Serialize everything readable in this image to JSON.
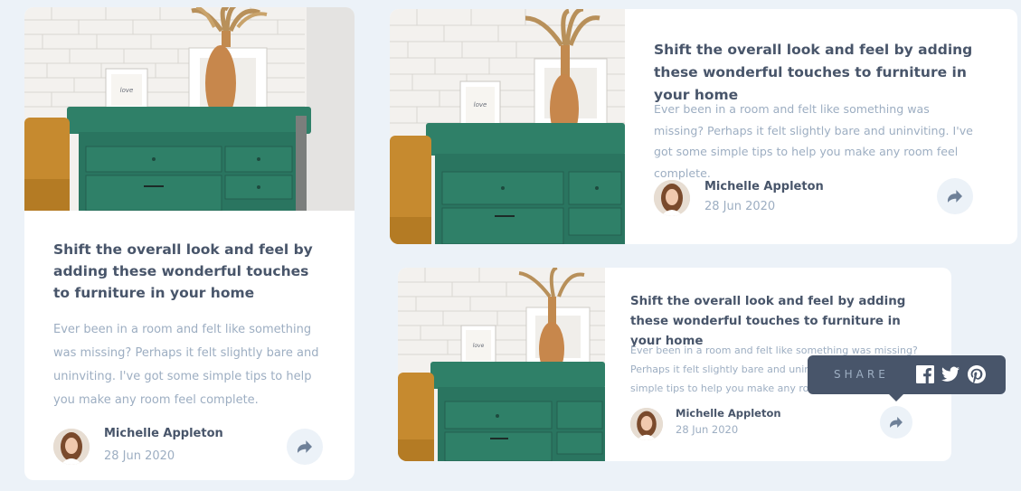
{
  "colors": {
    "background": "#ecf2f8",
    "card": "#ffffff",
    "title": "#48556a",
    "text": "#9daec2",
    "tooltip": "#48556a",
    "share_button_bg": "#ecf2f8"
  },
  "cards": [
    {
      "title": "Shift the overall look and feel by adding these wonderful touches to furniture in your home",
      "description": "Ever been in a room and felt like something was missing? Perhaps it felt slightly bare and uninviting. I've got some simple tips to help you make any room feel complete.",
      "author": "Michelle Appleton",
      "date": "28 Jun 2020",
      "image_alt": "green drawers with vase and picture frame",
      "share_icon": "share-arrow-icon"
    },
    {
      "title": "Shift the overall look and feel by adding these wonderful touches to furniture in your home",
      "description": "Ever been in a room and felt like something was missing? Perhaps it felt slightly bare and uninviting. I've got some simple tips to help you make any room feel complete.",
      "author": "Michelle Appleton",
      "date": "28 Jun 2020",
      "image_alt": "green drawers with vase and picture frame",
      "share_icon": "share-arrow-icon"
    },
    {
      "title": "Shift the overall look and feel by adding these wonderful touches to furniture in your home",
      "description": "Ever been in a room and felt like something was missing? Perhaps it felt slightly bare and uninviting. I've got some simple tips to help you make any room feel complete.",
      "author": "Michelle Appleton",
      "date": "28 Jun 2020",
      "image_alt": "green drawers with vase and picture frame",
      "share_icon": "share-arrow-icon"
    }
  ],
  "share_tooltip": {
    "label": "SHARE",
    "icons": [
      "facebook-icon",
      "twitter-icon",
      "pinterest-icon"
    ]
  }
}
